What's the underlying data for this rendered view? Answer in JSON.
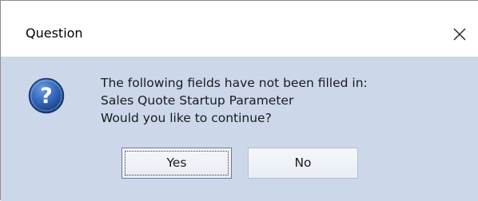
{
  "dialog": {
    "title": "Question",
    "icon": "question-icon",
    "message_lines": [
      "The following fields have not been filled in:",
      "Sales Quote Startup Parameter",
      "Would you like to continue?"
    ],
    "buttons": {
      "yes_label": "Yes",
      "no_label": "No"
    },
    "colors": {
      "body_background": "#ccd8ea",
      "title_background": "#ffffff",
      "icon_blue": "#2f64b8"
    }
  }
}
